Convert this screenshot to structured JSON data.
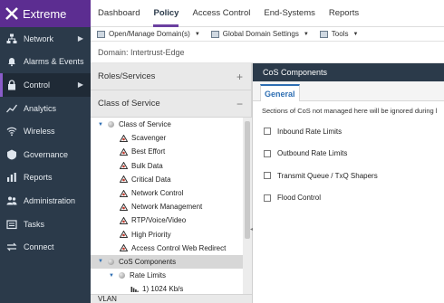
{
  "brand": {
    "name": "Extreme",
    "accent": "#5c2d91"
  },
  "nav": {
    "items": [
      {
        "label": "Network",
        "icon": "network-icon",
        "chevron": "▶",
        "active": false
      },
      {
        "label": "Alarms & Events",
        "icon": "bell-icon",
        "chevron": "",
        "active": false
      },
      {
        "label": "Control",
        "icon": "lock-icon",
        "chevron": "▶",
        "active": true
      },
      {
        "label": "Analytics",
        "icon": "analytics-icon",
        "chevron": "",
        "active": false
      },
      {
        "label": "Wireless",
        "icon": "wifi-icon",
        "chevron": "",
        "active": false
      },
      {
        "label": "Governance",
        "icon": "governance-icon",
        "chevron": "",
        "active": false
      },
      {
        "label": "Reports",
        "icon": "reports-icon",
        "chevron": "",
        "active": false
      },
      {
        "label": "Administration",
        "icon": "admin-icon",
        "chevron": "",
        "active": false
      },
      {
        "label": "Tasks",
        "icon": "tasks-icon",
        "chevron": "",
        "active": false
      },
      {
        "label": "Connect",
        "icon": "connect-icon",
        "chevron": "",
        "active": false
      }
    ]
  },
  "tabs": [
    "Dashboard",
    "Policy",
    "Access Control",
    "End-Systems",
    "Reports"
  ],
  "toolbar": {
    "open_manage": "Open/Manage Domain(s)",
    "global_settings": "Global Domain Settings",
    "tools": "Tools"
  },
  "domain": {
    "text": "Domain: Intertrust-Edge"
  },
  "left": {
    "roles_title": "Roles/Services",
    "roles_toggle": "+",
    "cos_title": "Class of Service",
    "cos_toggle": "−",
    "vlan_title": "VLAN",
    "tree": [
      {
        "label": "Class of Service",
        "level": 0,
        "kind": "dot",
        "expanded": true
      },
      {
        "label": "Scavenger",
        "level": 1,
        "kind": "tri"
      },
      {
        "label": "Best Effort",
        "level": 1,
        "kind": "tri"
      },
      {
        "label": "Bulk Data",
        "level": 1,
        "kind": "tri"
      },
      {
        "label": "Critical Data",
        "level": 1,
        "kind": "tri"
      },
      {
        "label": "Network Control",
        "level": 1,
        "kind": "tri"
      },
      {
        "label": "Network Management",
        "level": 1,
        "kind": "tri"
      },
      {
        "label": "RTP/Voice/Video",
        "level": 1,
        "kind": "tri"
      },
      {
        "label": "High Priority",
        "level": 1,
        "kind": "tri"
      },
      {
        "label": "Access Control Web Redirect",
        "level": 1,
        "kind": "tri"
      },
      {
        "label": "CoS Components",
        "level": 0,
        "kind": "dot",
        "expanded": true,
        "selected": true
      },
      {
        "label": "Rate Limits",
        "level": 1,
        "kind": "dot",
        "expanded": true
      },
      {
        "label": "1) 1024 Kb/s",
        "level": 2,
        "kind": "gauge"
      }
    ]
  },
  "right": {
    "title": "CoS Components",
    "tab": "General",
    "note": "Sections of CoS not managed here will be ignored during l",
    "checks": [
      "Inbound Rate Limits",
      "Outbound Rate Limits",
      "Transmit Queue / TxQ Shapers",
      "Flood Control"
    ]
  }
}
